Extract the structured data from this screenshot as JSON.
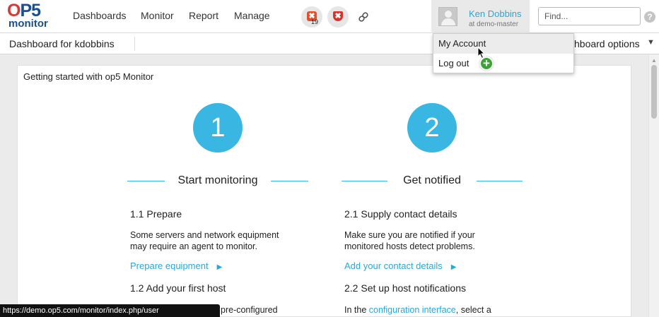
{
  "brand": {
    "logo_top": "OP5",
    "logo_bottom": "monitor"
  },
  "nav": {
    "items": [
      "Dashboards",
      "Monitor",
      "Report",
      "Manage"
    ]
  },
  "alerts": {
    "host_problems_count": "19",
    "link_icon": "link-icon"
  },
  "user": {
    "name": "Ken Dobbins",
    "host": "at demo-master"
  },
  "search": {
    "placeholder": "Find..."
  },
  "help": {
    "label": "?"
  },
  "subbar": {
    "dashboard_title": "Dashboard for kdobbins",
    "options_label": "shboard options",
    "caret": "▼"
  },
  "user_menu": {
    "items": [
      "My Account",
      "Log out"
    ]
  },
  "widget": {
    "title": "Getting started with op5 Monitor",
    "sections": [
      {
        "number": "1",
        "title": "Start monitoring",
        "steps": [
          {
            "title": "1.1 Prepare",
            "text_line1": "Some servers and network equipment",
            "text_line2": "may require an agent to monitor.",
            "cta": "Prepare equipment"
          },
          {
            "title": "1.2 Add your first host",
            "partial_text": "pre-configured"
          }
        ]
      },
      {
        "number": "2",
        "title": "Get notified",
        "steps": [
          {
            "title": "2.1 Supply contact details",
            "text_line1": "Make sure you are notified if your",
            "text_line2": "monitored hosts detect problems.",
            "cta": "Add your contact details"
          },
          {
            "title": "2.2 Set up host notifications",
            "text_prefix": "In the ",
            "link": "configuration interface",
            "text_suffix": ", select a"
          }
        ]
      }
    ]
  },
  "statusbar": {
    "url": "https://demo.op5.com/monitor/index.php/user"
  },
  "colors": {
    "accent": "#3ab6e3",
    "link": "#2aa7d6",
    "alert": "#d7332a",
    "add": "#3ba335"
  }
}
